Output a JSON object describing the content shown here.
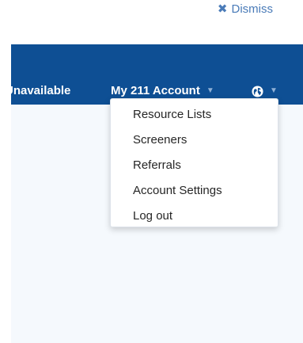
{
  "banner": {
    "dismiss_label": "Dismiss",
    "dismiss_icon": "close-icon"
  },
  "nav": {
    "unavailable_label": "Unavailable",
    "account_label": "My 211 Account",
    "globe_icon": "globe-icon",
    "caret_icon": "caret-down-icon"
  },
  "account_menu": {
    "items": [
      {
        "label": "Resource Lists"
      },
      {
        "label": "Screeners"
      },
      {
        "label": "Referrals"
      },
      {
        "label": "Account Settings"
      },
      {
        "label": "Log out"
      }
    ]
  },
  "colors": {
    "navbar": "#0e4f94",
    "link": "#4a7bb8",
    "content_bg": "#f5f9fd"
  }
}
